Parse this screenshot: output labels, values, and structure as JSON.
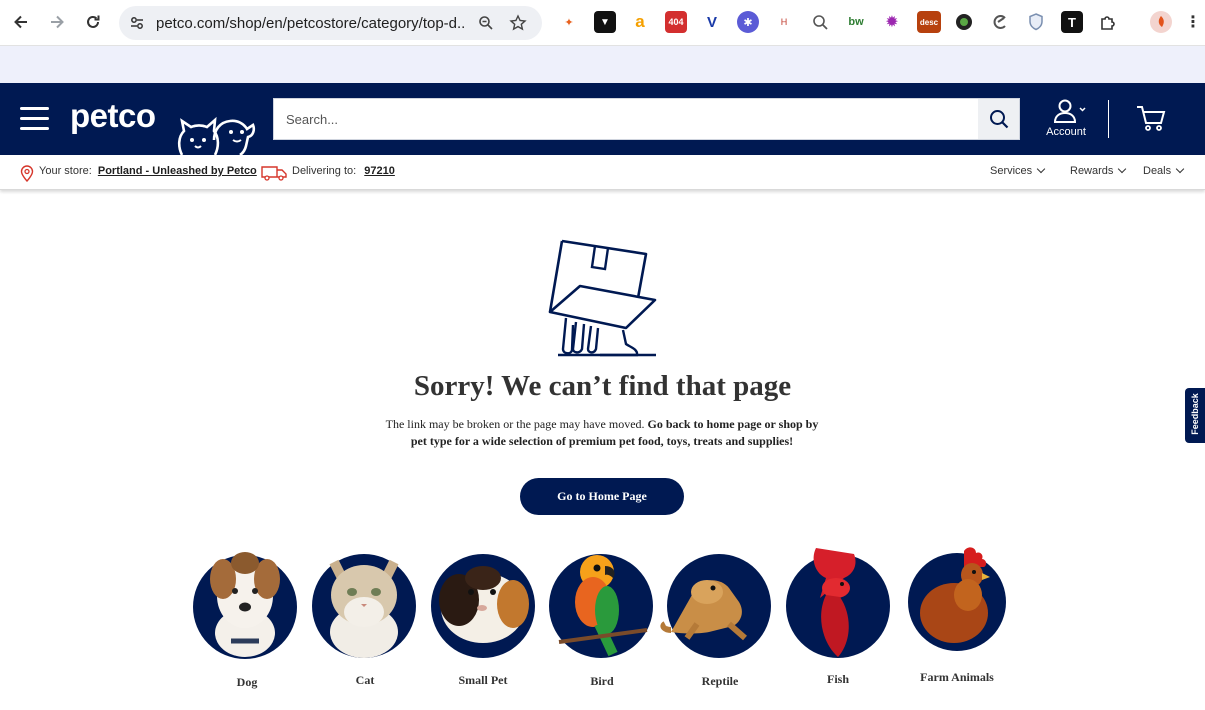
{
  "browser": {
    "url": "petco.com/shop/en/petcostore/category/top-d...",
    "extensions": [
      "ext-maple",
      "ext-wallet",
      "a",
      "404",
      "V",
      "ext-puzzle",
      "H",
      "ext-lens",
      "bw",
      "ext-gear",
      "desc",
      "ext-eye",
      "ext-c",
      "ext-shield",
      "T",
      "ext-extensions",
      "ext-avatar"
    ]
  },
  "header": {
    "logo": "petco",
    "search_placeholder": "Search...",
    "account_label": "Account"
  },
  "storebar": {
    "store_prefix": "Your store:",
    "store_name": "Portland - Unleashed by Petco",
    "delivering_prefix": "Delivering to:",
    "zip": "97210",
    "menus": [
      "Services",
      "Rewards",
      "Deals"
    ]
  },
  "main": {
    "title": "Sorry! We can’t find that page",
    "desc_regular": "The link may be broken or the page may have moved. ",
    "desc_bold": "Go back to home page or shop by pet type for a wide selection of premium pet food, toys, treats and supplies!",
    "home_button": "Go to Home Page"
  },
  "pets": [
    "Dog",
    "Cat",
    "Small Pet",
    "Bird",
    "Reptile",
    "Fish",
    "Farm Animals"
  ],
  "feedback": "Feedback",
  "colors": {
    "brand_navy": "#001952",
    "band": "#eef0fb"
  }
}
